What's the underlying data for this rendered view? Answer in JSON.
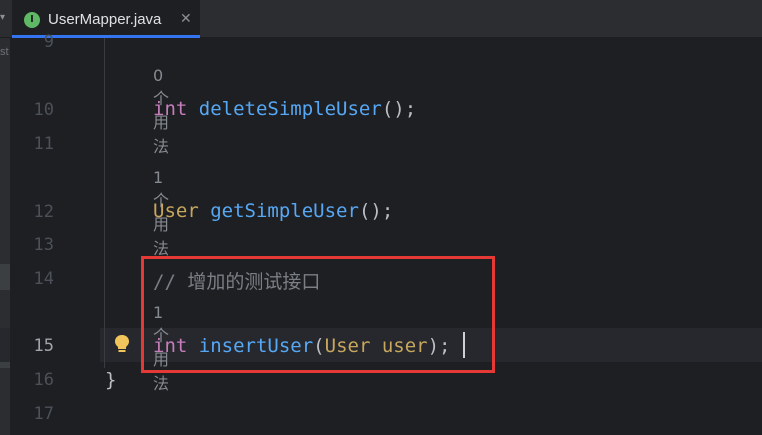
{
  "tabbar": {
    "left_arrow": "▾",
    "tab": {
      "icon_letter": "I",
      "label": "UserMapper.java",
      "close": "✕"
    }
  },
  "side": {
    "label": "st"
  },
  "gutter": {
    "lines": [
      {
        "num": "9"
      },
      {
        "num": "10"
      },
      {
        "num": "11"
      },
      {
        "num": "12"
      },
      {
        "num": "13"
      },
      {
        "num": "14"
      },
      {
        "num": "15"
      },
      {
        "num": "16"
      },
      {
        "num": "17"
      }
    ]
  },
  "code": {
    "usage_0": "0 个用法",
    "line10": {
      "type": "int",
      "name": "deleteSimpleUser",
      "rest": "();"
    },
    "usage_1a": "1 个用法",
    "line12": {
      "type": "User",
      "name": "getSimpleUser",
      "rest": "();"
    },
    "line14": {
      "comment": "// 增加的测试接口"
    },
    "usage_1b": "1 个用法",
    "line15": {
      "type": "int",
      "name": "insertUser",
      "open": "(",
      "ptype": "User",
      "pname": "user",
      "close": ");"
    },
    "line16": {
      "brace": "}"
    }
  },
  "colors": {
    "background": "#1e1f22",
    "keyword_type": "#c77dbb",
    "method": "#56a8f5",
    "comment": "#7a7e85",
    "highlight_box": "#e53935",
    "tab_underline": "#3574f0"
  },
  "icons": [
    "java-interface-icon",
    "close-icon",
    "lightbulb-icon"
  ]
}
